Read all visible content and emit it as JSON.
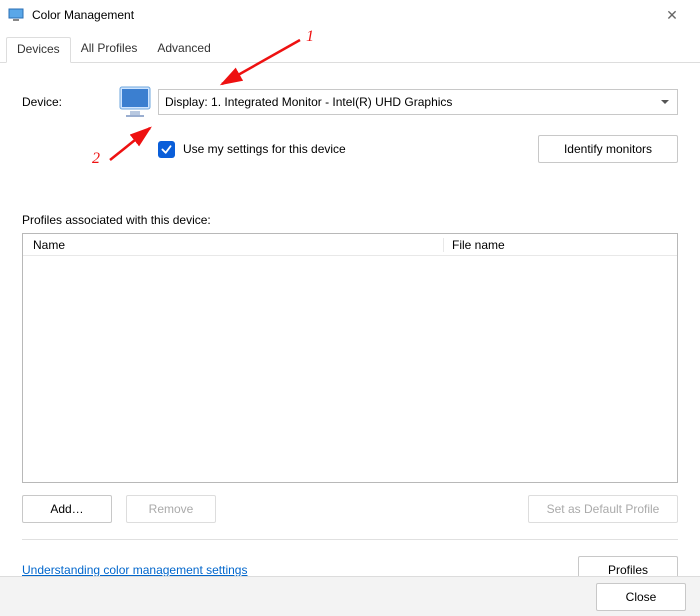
{
  "window": {
    "title": "Color Management"
  },
  "tabs": {
    "devices": "Devices",
    "all_profiles": "All Profiles",
    "advanced": "Advanced"
  },
  "device": {
    "label": "Device:",
    "selected": "Display: 1. Integrated Monitor - Intel(R) UHD Graphics"
  },
  "checkbox": {
    "label": "Use my settings for this device",
    "checked": true
  },
  "buttons": {
    "identify": "Identify monitors",
    "add": "Add…",
    "remove": "Remove",
    "set_default": "Set as Default Profile",
    "profiles": "Profiles",
    "close": "Close"
  },
  "profiles_section": {
    "heading": "Profiles associated with this device:",
    "col_name": "Name",
    "col_filename": "File name"
  },
  "link": {
    "label": "Understanding color management settings"
  },
  "annotations": {
    "n1": "1",
    "n2": "2"
  }
}
